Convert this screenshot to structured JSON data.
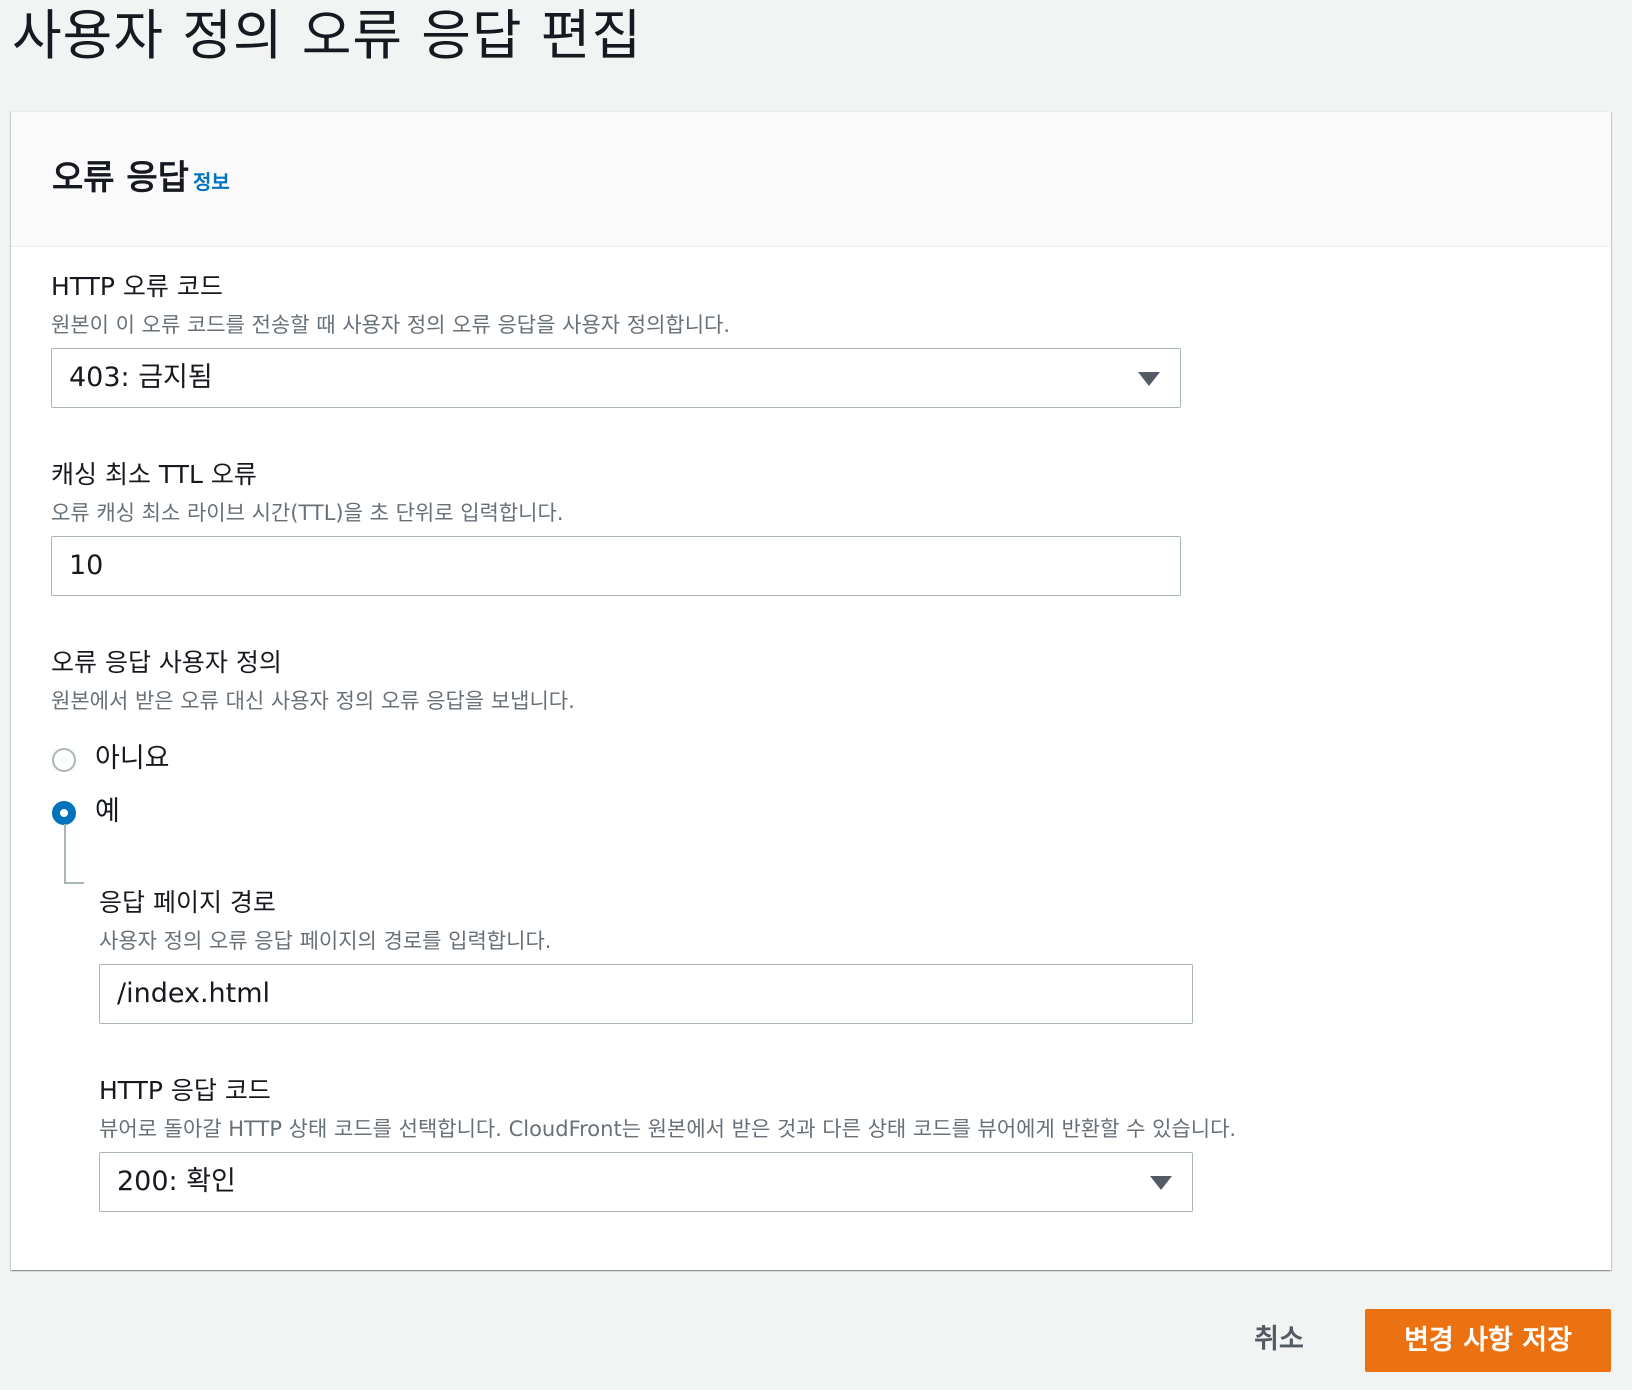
{
  "page": {
    "title": "사용자 정의 오류 응답 편집"
  },
  "panel": {
    "title": "오류 응답",
    "info_link": "정보"
  },
  "fields": {
    "http_error_code": {
      "label": "HTTP 오류 코드",
      "description": "원본이 이 오류 코드를 전송할 때 사용자 정의 오류 응답을 사용자 정의합니다.",
      "value": "403: 금지됨"
    },
    "min_ttl": {
      "label": "캐싱 최소 TTL 오류",
      "description": "오류 캐싱 최소 라이브 시간(TTL)을 초 단위로 입력합니다.",
      "value": "10"
    },
    "customize_response": {
      "label": "오류 응답 사용자 정의",
      "description": "원본에서 받은 오류 대신 사용자 정의 오류 응답을 보냅니다.",
      "options": [
        "아니요",
        "예"
      ],
      "selected": "예"
    },
    "response_page_path": {
      "label": "응답 페이지 경로",
      "description": "사용자 정의 오류 응답 페이지의 경로를 입력합니다.",
      "value": "/index.html"
    },
    "http_response_code": {
      "label": "HTTP 응답 코드",
      "description": "뷰어로 돌아갈 HTTP 상태 코드를 선택합니다. CloudFront는 원본에서 받은 것과 다른 상태 코드를 뷰어에게 반환할 수 있습니다.",
      "value": "200: 확인"
    }
  },
  "actions": {
    "cancel_label": "취소",
    "save_label": "변경 사항 저장"
  },
  "colors": {
    "primary_button": "#ec7211",
    "link": "#0073bb",
    "radio_selected": "#0073bb"
  },
  "icons": {
    "dropdown": "caret-down-icon"
  }
}
